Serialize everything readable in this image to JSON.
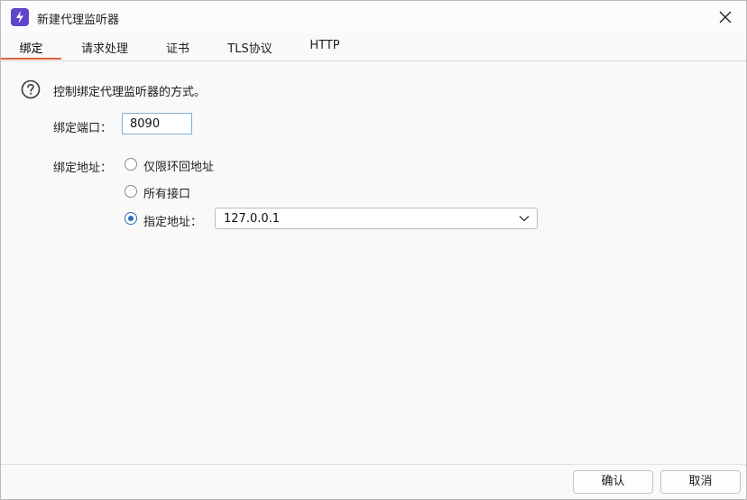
{
  "window": {
    "title": "新建代理监听器"
  },
  "tabs": [
    {
      "label": "绑定",
      "active": true
    },
    {
      "label": "请求处理",
      "active": false
    },
    {
      "label": "证书",
      "active": false
    },
    {
      "label": "TLS协议",
      "active": false
    },
    {
      "label": "HTTP",
      "active": false
    }
  ],
  "content": {
    "description": "控制绑定代理监听器的方式。",
    "port": {
      "label": "绑定端口：",
      "value": "8090"
    },
    "address": {
      "label": "绑定地址：",
      "options": [
        {
          "label": "仅限环回地址",
          "checked": false
        },
        {
          "label": "所有接口",
          "checked": false
        },
        {
          "label": "指定地址：",
          "checked": true
        }
      ],
      "selected_address": "127.0.0.1"
    }
  },
  "footer": {
    "ok_label": "确认",
    "cancel_label": "取消"
  },
  "colors": {
    "accent": "#e0633a",
    "radio": "#2f6db5",
    "app_icon": "#5e45c9"
  },
  "icons": {
    "app": "lightning-icon",
    "close": "close-icon",
    "help": "question-icon",
    "dropdown": "chevron-down-icon"
  }
}
